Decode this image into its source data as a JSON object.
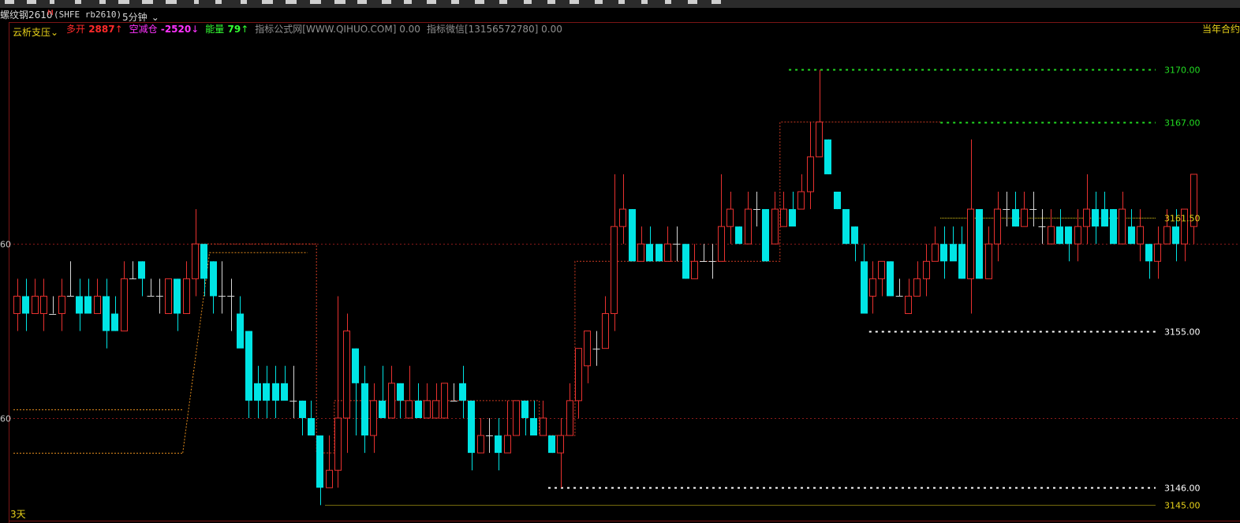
{
  "title_bar": {
    "instrument": "螺纹钢2610",
    "instrument_flag": "M",
    "contract_code": "(SHFE rb2610)",
    "period": "5分钟",
    "dropdown_glyph": "⌄"
  },
  "indicator_line": {
    "name": "云析支压",
    "name_chevron": "⌄",
    "items": [
      {
        "label": "多开",
        "value": "2887",
        "arrow": "↑",
        "color": "#ff2a2a"
      },
      {
        "label": "空减仓",
        "value": "-2520",
        "arrow": "↓",
        "color": "#ff33ff"
      },
      {
        "label": "能量",
        "value": "79",
        "arrow": "↑",
        "color": "#33ff33"
      },
      {
        "label": "指标公式网[WWW.QIHUO.COM]",
        "value": "0.00",
        "arrow": "",
        "color": "#909090"
      },
      {
        "label": "指标微信[13156572780]",
        "value": "0.00",
        "arrow": "",
        "color": "#909090"
      }
    ],
    "right_label": "当年合约"
  },
  "footer": {
    "label": "3天"
  },
  "colors": {
    "up_candle": "#e8312f",
    "down_candle": "#00e5e5",
    "wick": "#d7d7d7",
    "pressure_line": "#cc3a22",
    "support_line": "#e08a1c",
    "green_level": "#22dd22",
    "white_level": "#ffffff",
    "yellow_level": "#e8d21a"
  },
  "chart_data": {
    "type": "candlestick",
    "ylim": [
      3144.2,
      3171.2
    ],
    "y_ticks": [
      {
        "label": "60",
        "value": 3160
      },
      {
        "label": "60",
        "value": 3150
      }
    ],
    "levels": [
      {
        "label": "3170.00",
        "value": 3170.0,
        "from_bar": 87,
        "style": "green"
      },
      {
        "label": "3167.00",
        "value": 3167.0,
        "from_bar": 104,
        "style": "green"
      },
      {
        "label": "3161.50",
        "value": 3161.5,
        "from_bar": 104,
        "style": "yellow"
      },
      {
        "label": "3155.00",
        "value": 3155.0,
        "from_bar": 96,
        "style": "white"
      },
      {
        "label": "3146.00",
        "value": 3146.0,
        "from_bar": 60,
        "style": "white"
      },
      {
        "label": "3145.00",
        "value": 3145.0,
        "from_bar": 35,
        "style": "yellow"
      }
    ],
    "pressure": [
      {
        "bars": [
          20,
          34
        ],
        "value": 3160
      },
      {
        "bars": [
          34,
          36
        ],
        "value": 3148
      },
      {
        "bars": [
          36,
          59
        ],
        "value": 3151
      },
      {
        "bars": [
          59,
          63
        ],
        "value": 3149
      },
      {
        "bars": [
          63,
          86
        ],
        "value": 3159
      },
      {
        "bars": [
          86,
          104
        ],
        "value": 3167
      }
    ],
    "support": [
      {
        "bars": [
          0,
          19
        ],
        "value": 3150.5
      },
      {
        "bars": [
          0,
          19
        ],
        "value": 3148
      }
    ],
    "candles": [
      [
        3156,
        3157,
        3155,
        3158,
        3155
      ],
      [
        3157,
        3156,
        3155,
        3158,
        3154
      ],
      [
        3156,
        3157,
        3156,
        3158,
        3155
      ],
      [
        3156,
        3157,
        3155,
        3158,
        3155
      ],
      [
        3156,
        3156,
        3156,
        3157,
        3154
      ],
      [
        3156,
        3157,
        3155,
        3158,
        3155
      ],
      [
        3157,
        3157,
        3157,
        3159,
        3156
      ],
      [
        3157,
        3156,
        3155,
        3158,
        3156
      ],
      [
        3157,
        3156,
        3156,
        3158,
        3156
      ],
      [
        3156,
        3157,
        3156,
        3158,
        3155
      ],
      [
        3157,
        3155,
        3154,
        3158,
        3155
      ],
      [
        3156,
        3155,
        3155,
        3157,
        3155
      ],
      [
        3155,
        3158,
        3155,
        3159,
        3155
      ],
      [
        3158,
        3158,
        3158,
        3159,
        3157
      ],
      [
        3159,
        3158,
        3157,
        3159,
        3158
      ],
      [
        3157,
        3157,
        3157,
        3158,
        3155
      ],
      [
        3157,
        3157,
        3156,
        3158,
        3155
      ],
      [
        3156,
        3158,
        3156,
        3158,
        3155
      ],
      [
        3158,
        3156,
        3155,
        3158,
        3156
      ],
      [
        3156,
        3158,
        3156,
        3159,
        3155
      ],
      [
        3158,
        3160,
        3157,
        3162,
        3158
      ],
      [
        3160,
        3158,
        3157,
        3160,
        3158
      ],
      [
        3159,
        3157,
        3156,
        3159,
        3157
      ],
      [
        3157,
        3157,
        3156,
        3159,
        3155
      ],
      [
        3157,
        3157,
        3155,
        3158,
        3156
      ],
      [
        3156,
        3154,
        3155,
        3157,
        3154
      ],
      [
        3155,
        3151,
        3150,
        3155,
        3151
      ],
      [
        3152,
        3151,
        3150,
        3153,
        3152
      ],
      [
        3152,
        3151,
        3150,
        3153,
        3150
      ],
      [
        3152,
        3151,
        3150,
        3153,
        3151
      ],
      [
        3152,
        3151,
        3152,
        3153,
        3150
      ],
      [
        3151,
        3151,
        3150,
        3153,
        3151
      ],
      [
        3151,
        3150,
        3149,
        3151,
        3150
      ],
      [
        3150,
        3149,
        3149,
        3151,
        3149
      ],
      [
        3149,
        3146,
        3145,
        3149,
        3146
      ],
      [
        3146,
        3147,
        3146,
        3149,
        3145
      ],
      [
        3147,
        3150,
        3146,
        3157,
        3147
      ],
      [
        3150,
        3155,
        3148,
        3156,
        3150
      ],
      [
        3154,
        3152,
        3149,
        3154,
        3152
      ],
      [
        3152,
        3149,
        3148,
        3153,
        3149
      ],
      [
        3149,
        3151,
        3148,
        3152,
        3147
      ],
      [
        3151,
        3150,
        3150,
        3153,
        3151
      ],
      [
        3150,
        3152,
        3150,
        3153,
        3150
      ],
      [
        3152,
        3151,
        3150,
        3152,
        3151
      ],
      [
        3150,
        3151,
        3150,
        3153,
        3149
      ],
      [
        3151,
        3150,
        3150,
        3152,
        3150
      ],
      [
        3150,
        3151,
        3150,
        3152,
        3150
      ],
      [
        3150,
        3151,
        3150,
        3152,
        3149
      ],
      [
        3150,
        3152,
        3150,
        3152,
        3151
      ],
      [
        3151,
        3151,
        3151,
        3152,
        3150
      ],
      [
        3152,
        3151,
        3150,
        3153,
        3151
      ],
      [
        3151,
        3148,
        3147,
        3151,
        3148
      ],
      [
        3148,
        3149,
        3148,
        3150,
        3149
      ],
      [
        3149,
        3149,
        3148,
        3150,
        3149
      ],
      [
        3149,
        3148,
        3147,
        3150,
        3148
      ],
      [
        3148,
        3149,
        3148,
        3151,
        3148
      ],
      [
        3149,
        3151,
        3149,
        3151,
        3149
      ],
      [
        3151,
        3150,
        3149,
        3151,
        3150
      ],
      [
        3150,
        3149,
        3149,
        3151,
        3150
      ],
      [
        3149,
        3150,
        3149,
        3151,
        3148
      ],
      [
        3149,
        3148,
        3148,
        3149,
        3148
      ],
      [
        3148,
        3149,
        3146,
        3150,
        3149
      ],
      [
        3149,
        3151,
        3149,
        3152,
        3150
      ],
      [
        3151,
        3154,
        3150,
        3154,
        3151
      ],
      [
        3153,
        3155,
        3152,
        3155,
        3154
      ],
      [
        3154,
        3154,
        3153,
        3155,
        3154
      ],
      [
        3154,
        3156,
        3154,
        3157,
        3154
      ],
      [
        3156,
        3161,
        3155,
        3164,
        3156
      ],
      [
        3161,
        3162,
        3160,
        3164,
        3162
      ],
      [
        3162,
        3159,
        3159,
        3162,
        3159
      ],
      [
        3159,
        3160,
        3159,
        3161,
        3159
      ],
      [
        3160,
        3159,
        3159,
        3161,
        3159
      ],
      [
        3160,
        3159,
        3159,
        3160,
        3159
      ],
      [
        3159,
        3160,
        3159,
        3161,
        3159
      ],
      [
        3160,
        3160,
        3159,
        3161,
        3159
      ],
      [
        3160,
        3158,
        3158,
        3160,
        3158
      ],
      [
        3158,
        3159,
        3158,
        3160,
        3157
      ],
      [
        3159,
        3159,
        3159,
        3160,
        3158
      ],
      [
        3159,
        3159,
        3158,
        3160,
        3158
      ],
      [
        3159,
        3161,
        3159,
        3164,
        3159
      ],
      [
        3161,
        3162,
        3160,
        3163,
        3161
      ],
      [
        3161,
        3160,
        3160,
        3161,
        3160
      ],
      [
        3160,
        3162,
        3161,
        3163,
        3161
      ],
      [
        3162,
        3162,
        3161,
        3163,
        3162
      ],
      [
        3162,
        3159,
        3159,
        3162,
        3160
      ],
      [
        3160,
        3162,
        3160,
        3163,
        3160
      ],
      [
        3161,
        3162,
        3161,
        3163,
        3161
      ],
      [
        3162,
        3161,
        3162,
        3163,
        3161
      ],
      [
        3162,
        3163,
        3162,
        3164,
        3162
      ],
      [
        3163,
        3165,
        3162,
        3167,
        3163
      ],
      [
        3165,
        3167,
        3165,
        3170,
        3165
      ],
      [
        3166,
        3164,
        3164,
        3166,
        3165
      ],
      [
        3163,
        3162,
        3162,
        3163,
        3162
      ],
      [
        3162,
        3160,
        3160,
        3161,
        3160
      ],
      [
        3161,
        3160,
        3159,
        3161,
        3160
      ],
      [
        3159,
        3156,
        3156,
        3160,
        3157
      ],
      [
        3157,
        3158,
        3156,
        3159,
        3156
      ],
      [
        3158,
        3159,
        3157,
        3159,
        3158
      ],
      [
        3159,
        3157,
        3157,
        3159,
        3157
      ],
      [
        3157,
        3157,
        3157,
        3158,
        3155
      ],
      [
        3156,
        3157,
        3156,
        3158,
        3156
      ],
      [
        3157,
        3158,
        3157,
        3159,
        3157
      ],
      [
        3158,
        3159,
        3157,
        3160,
        3158
      ],
      [
        3159,
        3160,
        3159,
        3161,
        3159
      ],
      [
        3160,
        3159,
        3158,
        3161,
        3159
      ],
      [
        3160,
        3159,
        3160,
        3161,
        3158
      ],
      [
        3160,
        3158,
        3158,
        3161,
        3159
      ],
      [
        3158,
        3162,
        3156,
        3166,
        3158
      ],
      [
        3162,
        3158,
        3158,
        3162,
        3158
      ],
      [
        3158,
        3160,
        3158,
        3161,
        3158
      ],
      [
        3160,
        3162,
        3159,
        3163,
        3160
      ],
      [
        3162,
        3162,
        3161,
        3163,
        3162
      ],
      [
        3162,
        3161,
        3161,
        3163,
        3162
      ],
      [
        3161,
        3162,
        3161,
        3163,
        3162
      ],
      [
        3162,
        3162,
        3161,
        3163,
        3161
      ],
      [
        3161,
        3161,
        3160,
        3162,
        3161
      ],
      [
        3160,
        3161,
        3160,
        3162,
        3160
      ],
      [
        3161,
        3160,
        3160,
        3162,
        3160
      ],
      [
        3161,
        3160,
        3159,
        3161,
        3160
      ],
      [
        3160,
        3161,
        3159,
        3162,
        3160
      ],
      [
        3161,
        3162,
        3160,
        3164,
        3161
      ],
      [
        3162,
        3161,
        3160,
        3163,
        3161
      ],
      [
        3162,
        3161,
        3161,
        3163,
        3162
      ],
      [
        3162,
        3160,
        3160,
        3162,
        3160
      ],
      [
        3160,
        3162,
        3160,
        3163,
        3160
      ],
      [
        3161,
        3160,
        3160,
        3162,
        3160
      ],
      [
        3160,
        3161,
        3159,
        3162,
        3160
      ],
      [
        3160,
        3159,
        3158,
        3160,
        3159
      ],
      [
        3159,
        3160,
        3158,
        3161,
        3159
      ],
      [
        3160,
        3161,
        3160,
        3162,
        3160
      ],
      [
        3161,
        3160,
        3159,
        3162,
        3160
      ],
      [
        3160,
        3162,
        3159,
        3162,
        3160
      ],
      [
        3161,
        3164,
        3160,
        3164,
        3161
      ]
    ]
  }
}
